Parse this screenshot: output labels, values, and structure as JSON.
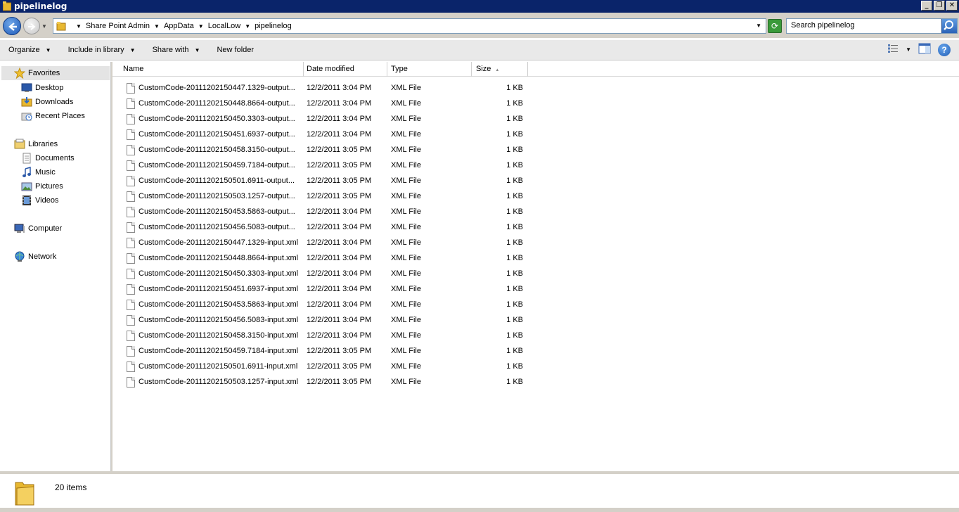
{
  "window": {
    "title": "pipelinelog",
    "minimize_label": "_",
    "maximize_label": "❐",
    "close_label": "✕"
  },
  "address": {
    "breadcrumbs": [
      "Share Point Admin",
      "AppData",
      "LocalLow",
      "pipelinelog"
    ],
    "refresh_icon": "refresh-icon"
  },
  "search": {
    "placeholder": "Search pipelinelog"
  },
  "toolbar": {
    "organize": "Organize",
    "include_in_library": "Include in library",
    "share_with": "Share with",
    "new_folder": "New folder"
  },
  "nav": {
    "favorites": "Favorites",
    "desktop": "Desktop",
    "downloads": "Downloads",
    "recent_places": "Recent Places",
    "libraries": "Libraries",
    "documents": "Documents",
    "music": "Music",
    "pictures": "Pictures",
    "videos": "Videos",
    "computer": "Computer",
    "network": "Network"
  },
  "columns": {
    "name": "Name",
    "date_modified": "Date modified",
    "type": "Type",
    "size": "Size"
  },
  "files": [
    {
      "name": "CustomCode-20111202150447.1329-output...",
      "date": "12/2/2011 3:04 PM",
      "type": "XML File",
      "size": "1 KB"
    },
    {
      "name": "CustomCode-20111202150448.8664-output...",
      "date": "12/2/2011 3:04 PM",
      "type": "XML File",
      "size": "1 KB"
    },
    {
      "name": "CustomCode-20111202150450.3303-output...",
      "date": "12/2/2011 3:04 PM",
      "type": "XML File",
      "size": "1 KB"
    },
    {
      "name": "CustomCode-20111202150451.6937-output...",
      "date": "12/2/2011 3:04 PM",
      "type": "XML File",
      "size": "1 KB"
    },
    {
      "name": "CustomCode-20111202150458.3150-output...",
      "date": "12/2/2011 3:05 PM",
      "type": "XML File",
      "size": "1 KB"
    },
    {
      "name": "CustomCode-20111202150459.7184-output...",
      "date": "12/2/2011 3:05 PM",
      "type": "XML File",
      "size": "1 KB"
    },
    {
      "name": "CustomCode-20111202150501.6911-output...",
      "date": "12/2/2011 3:05 PM",
      "type": "XML File",
      "size": "1 KB"
    },
    {
      "name": "CustomCode-20111202150503.1257-output...",
      "date": "12/2/2011 3:05 PM",
      "type": "XML File",
      "size": "1 KB"
    },
    {
      "name": "CustomCode-20111202150453.5863-output...",
      "date": "12/2/2011 3:04 PM",
      "type": "XML File",
      "size": "1 KB"
    },
    {
      "name": "CustomCode-20111202150456.5083-output...",
      "date": "12/2/2011 3:04 PM",
      "type": "XML File",
      "size": "1 KB"
    },
    {
      "name": "CustomCode-20111202150447.1329-input.xml",
      "date": "12/2/2011 3:04 PM",
      "type": "XML File",
      "size": "1 KB"
    },
    {
      "name": "CustomCode-20111202150448.8664-input.xml",
      "date": "12/2/2011 3:04 PM",
      "type": "XML File",
      "size": "1 KB"
    },
    {
      "name": "CustomCode-20111202150450.3303-input.xml",
      "date": "12/2/2011 3:04 PM",
      "type": "XML File",
      "size": "1 KB"
    },
    {
      "name": "CustomCode-20111202150451.6937-input.xml",
      "date": "12/2/2011 3:04 PM",
      "type": "XML File",
      "size": "1 KB"
    },
    {
      "name": "CustomCode-20111202150453.5863-input.xml",
      "date": "12/2/2011 3:04 PM",
      "type": "XML File",
      "size": "1 KB"
    },
    {
      "name": "CustomCode-20111202150456.5083-input.xml",
      "date": "12/2/2011 3:04 PM",
      "type": "XML File",
      "size": "1 KB"
    },
    {
      "name": "CustomCode-20111202150458.3150-input.xml",
      "date": "12/2/2011 3:04 PM",
      "type": "XML File",
      "size": "1 KB"
    },
    {
      "name": "CustomCode-20111202150459.7184-input.xml",
      "date": "12/2/2011 3:05 PM",
      "type": "XML File",
      "size": "1 KB"
    },
    {
      "name": "CustomCode-20111202150501.6911-input.xml",
      "date": "12/2/2011 3:05 PM",
      "type": "XML File",
      "size": "1 KB"
    },
    {
      "name": "CustomCode-20111202150503.1257-input.xml",
      "date": "12/2/2011 3:05 PM",
      "type": "XML File",
      "size": "1 KB"
    }
  ],
  "status": {
    "item_count": "20 items"
  }
}
